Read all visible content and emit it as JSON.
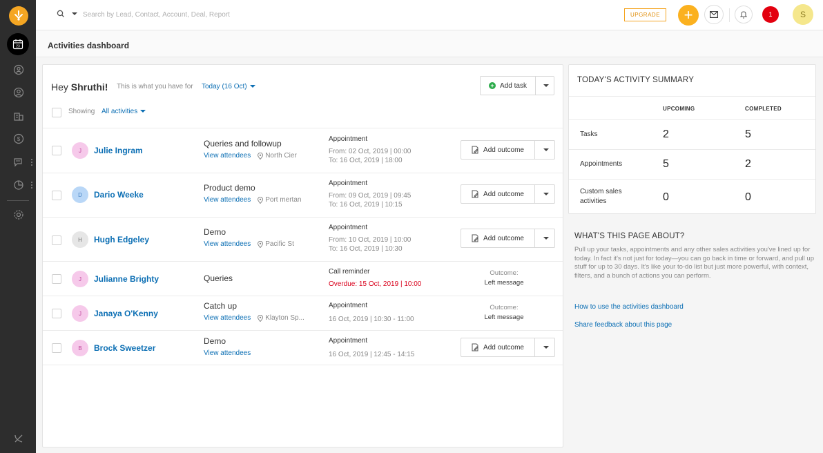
{
  "topbar": {
    "search_placeholder": "Search by Lead, Contact, Account, Deal, Report",
    "upgrade_label": "UPGRADE",
    "plus_label": "+",
    "notification_count": "1",
    "user_initial": "S"
  },
  "sidebar": {
    "items": [
      "calendar-icon",
      "leads-icon",
      "contacts-icon",
      "accounts-icon",
      "deals-icon",
      "chat-icon",
      "reports-icon",
      "settings-icon",
      "phone-off-icon"
    ]
  },
  "page": {
    "title": "Activities dashboard"
  },
  "greeting": {
    "hey": "Hey ",
    "name": "Shruthi!",
    "subtitle": "This is what you have for",
    "date_filter": "Today (16 Oct)",
    "showing_label": "Showing",
    "showing_value": "All activities",
    "add_task_label": "Add task"
  },
  "activities": [
    {
      "initial": "J",
      "name": "Julie Ingram",
      "title": "Queries and followup",
      "link": "View attendees",
      "location": "North Cier",
      "type": "Appointment",
      "time1": "From: 02 Oct, 2019 | 00:00",
      "time2": "To: 16 Oct, 2019 | 18:00",
      "action": "Add outcome"
    },
    {
      "initial": "D",
      "name": "Dario Weeke",
      "title": "Product demo",
      "link": "View attendees",
      "location": "Port mertan",
      "type": "Appointment",
      "time1": "From: 09 Oct, 2019 | 09:45",
      "time2": "To: 16 Oct, 2019 | 10:15",
      "action": "Add outcome"
    },
    {
      "initial": "H",
      "name": "Hugh Edgeley",
      "title": "Demo",
      "link": "View attendees",
      "location": "Pacific St",
      "type": "Appointment",
      "time1": "From: 10 Oct, 2019 | 10:00",
      "time2": "To: 16 Oct, 2019 | 10:30",
      "action": "Add outcome"
    },
    {
      "initial": "J",
      "name": "Julianne Brighty",
      "title": "Queries",
      "type": "Call reminder",
      "time1": "Overdue: 15 Oct, 2019 | 10:00",
      "outcome_label": "Outcome:",
      "outcome_value": "Left message"
    },
    {
      "initial": "J",
      "name": "Janaya O'Kenny",
      "title": "Catch up",
      "link": "View attendees",
      "location": "Klayton Sp...",
      "type": "Appointment",
      "time1": "16 Oct, 2019 | 10:30 - 11:00",
      "outcome_label": "Outcome:",
      "outcome_value": "Left message"
    },
    {
      "initial": "B",
      "name": "Brock Sweetzer",
      "title": "Demo",
      "link": "View attendees",
      "type": "Appointment",
      "time1": "16 Oct, 2019 | 12:45 - 14:15",
      "action": "Add outcome"
    }
  ],
  "summary": {
    "title": "TODAY'S ACTIVITY SUMMARY",
    "col_upcoming": "UPCOMING",
    "col_completed": "COMPLETED",
    "rows": [
      {
        "label": "Tasks",
        "upcoming": "2",
        "completed": "5"
      },
      {
        "label": "Appointments",
        "upcoming": "5",
        "completed": "2"
      },
      {
        "label_line1": "Custom sales",
        "label_line2": "activities",
        "upcoming": "0",
        "completed": "0"
      }
    ]
  },
  "about": {
    "title": "WHAT'S THIS PAGE ABOUT?",
    "text": "Pull up your tasks, appointments and any other sales activities you've lined up for today. In fact it's not just for today—you can go back in time or forward, and pull up stuff for up to 30 days. It's like your to-do list but just more powerful, with context, filters, and a bunch of actions you can perform.",
    "link1": "How to use the activities dashboard",
    "link2": "Share feedback about this page"
  },
  "colors": {
    "accent": "#fbb11f",
    "link": "#0c6fb4",
    "overdue": "#d9001b",
    "sidebar": "#2d2d2d"
  }
}
